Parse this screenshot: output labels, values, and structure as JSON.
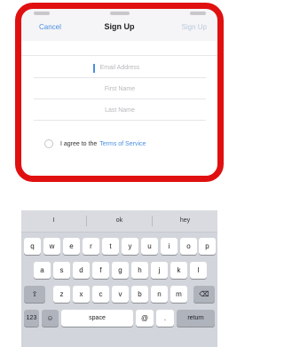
{
  "nav": {
    "cancel_label": "Cancel",
    "title": "Sign Up",
    "signup_label": "Sign Up"
  },
  "form": {
    "email_placeholder": "Email Address",
    "first_name_placeholder": "First Name",
    "last_name_placeholder": "Last Name",
    "agree_text": "I agree to the",
    "tos_link": "Terms of Service"
  },
  "keyboard": {
    "suggestions": [
      "I",
      "ok",
      "hey"
    ],
    "row1": [
      "q",
      "w",
      "e",
      "r",
      "t",
      "y",
      "u",
      "i",
      "o",
      "p"
    ],
    "row2": [
      "a",
      "s",
      "d",
      "f",
      "g",
      "h",
      "j",
      "k",
      "l"
    ],
    "row3": [
      "z",
      "x",
      "c",
      "v",
      "b",
      "n",
      "m"
    ],
    "shift_icon": "⇧",
    "delete_icon": "⌫",
    "numbers_label": "123",
    "emoji_icon": "☺",
    "space_label": "space",
    "at_label": "@",
    "period_label": ".",
    "return_label": "return"
  },
  "colors": {
    "highlight": "#e01010",
    "link": "#4a8fe0"
  }
}
